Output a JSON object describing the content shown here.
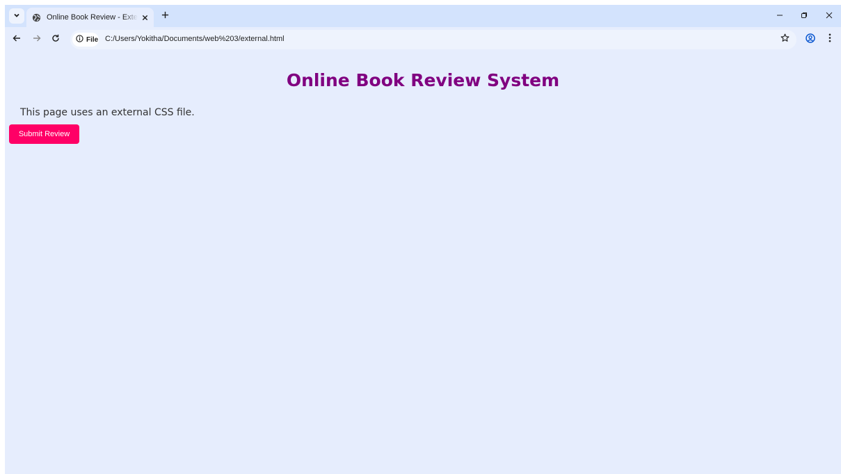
{
  "browser": {
    "tab_title": "Online Book Review - External CSS",
    "address_chip_label": "File",
    "url": "C:/Users/Yokitha/Documents/web%203/external.html"
  },
  "page": {
    "heading": "Online Book Review System",
    "paragraph": "This page uses an external CSS file.",
    "submit_label": "Submit Review"
  },
  "colors": {
    "heading": "#800080",
    "button": "#ff0066",
    "background": "#e6edfd"
  }
}
